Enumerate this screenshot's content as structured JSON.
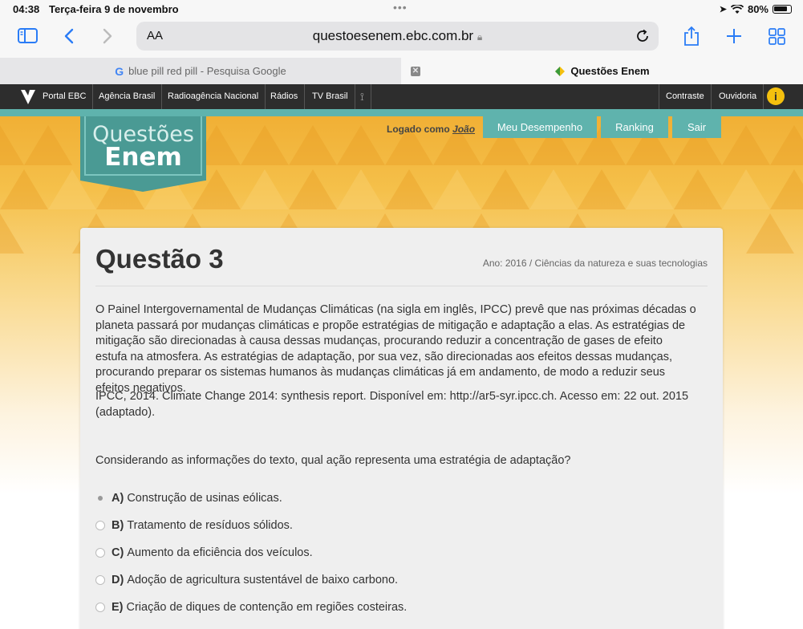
{
  "status": {
    "time": "04:38",
    "date": "Terça-feira 9 de novembro",
    "battery": "80%"
  },
  "browser": {
    "aa_label": "AA",
    "url": "questoesenem.ebc.com.br",
    "tabs": [
      {
        "title": "blue pill red pill - Pesquisa Google",
        "active": false
      },
      {
        "title": "Questões Enem",
        "active": true
      }
    ]
  },
  "ebc_nav": {
    "items": [
      "Portal EBC",
      "Agência Brasil",
      "Radioagência Nacional",
      "Rádios",
      "TV Brasil"
    ],
    "right_items": [
      "Contraste",
      "Ouvidoria"
    ]
  },
  "header": {
    "logo_line1": "Questões",
    "logo_line2": "Enem",
    "logged_prefix": "Logado como",
    "user": "João",
    "nav": [
      "Meu Desempenho",
      "Ranking",
      "Sair"
    ]
  },
  "question": {
    "title": "Questão 3",
    "meta": "Ano: 2016 / Ciências da natureza e suas tecnologias",
    "text": "O Painel Intergovernamental de Mudanças Climáticas (na sigla em inglês, IPCC) prevê que nas próximas décadas o planeta passará por mudanças climáticas e propõe estratégias de mitigação e adaptação a elas. As estratégias de mitigação são direcionadas à causa dessas mudanças, procurando reduzir a concentração de gases de efeito estufa na atmosfera. As estratégias de adaptação, por sua vez, são direcionadas aos efeitos dessas mudanças, procurando preparar os sistemas humanos às mudanças climáticas já em andamento, de modo a reduzir seus efeitos negativos.",
    "source": "IPCC, 2014. Climate Change 2014: synthesis report. Disponível em: http://ar5-syr.ipcc.ch. Acesso em: 22 out. 2015 (adaptado).",
    "prompt": "Considerando as informações do texto, qual ação representa uma estratégia de adaptação?",
    "options": [
      {
        "letter": "A)",
        "text": "Construção de usinas eólicas.",
        "selected": true
      },
      {
        "letter": "B)",
        "text": "Tratamento de resíduos sólidos.",
        "selected": false
      },
      {
        "letter": "C)",
        "text": "Aumento da eficiência dos veículos.",
        "selected": false
      },
      {
        "letter": "D)",
        "text": "Adoção de agricultura sustentável de baixo carbono.",
        "selected": false
      },
      {
        "letter": "E)",
        "text": "Criação de diques de contenção em regiões costeiras.",
        "selected": false
      }
    ]
  },
  "colors": {
    "teal": "#5fb3ad",
    "teal_dark": "#4a9a94",
    "safari_blue": "#2a7cf6",
    "ebc_bar": "#2d2d2d",
    "header_yellow": "#f0ae33"
  }
}
